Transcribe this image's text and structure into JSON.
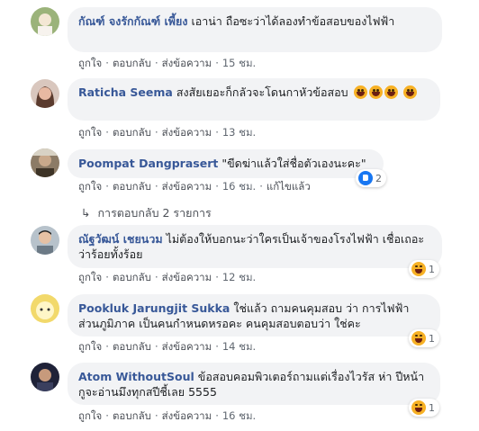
{
  "actions": {
    "like": "ถูกใจ",
    "reply": "ตอบกลับ",
    "message": "ส่งข้อความ",
    "edited": "แก้ไขแล้ว"
  },
  "comments": [
    {
      "name": "กัณฑ์ จงรักกัณฑ์ เพี้ยง",
      "text": "เอาน่า ถือซะว่าได้ลองทำข้อสอบของไฟฟ้า",
      "time": "15 ชม.",
      "avatar_color": "#9bb37a"
    },
    {
      "name": "Raticha Seema",
      "text": "สงสัยเยอะก็กลัวจะโดนกาหัวข้อสอบ",
      "time": "13 ชม.",
      "avatar_color": "#a87f72",
      "emoji": [
        "grinning-squint-emoji",
        "grinning-squint-emoji",
        "grinning-squint-emoji",
        "grinning-squint-emoji"
      ]
    },
    {
      "name": "Poompat Dangprasert",
      "text": "\"ขีดฆ่าแล้วใส่ชื่อตัวเองนะคะ\"",
      "time": "16 ชม.",
      "avatar_color": "#5f5040",
      "reaction": {
        "icon": "like-icon",
        "count": "2"
      }
    },
    {
      "name": "ณัฐวัฒน์ เชยนวม",
      "text": "ไม่ต้องให้บอกนะว่าใครเป็นเจ้าของโรงไฟฟ้า เชื่อเถอะว่าร้อยทั้งร้อย",
      "time": "12 ชม.",
      "avatar_color": "#6c7a86",
      "reaction": {
        "icon": "haha-icon",
        "count": "1"
      }
    },
    {
      "name": "Pookluk Jarungjit Sukka",
      "text": "ใช่แล้ว ถามคนคุมสอบ ว่า การไฟฟ้าส่วนภูมิภาค เป็นคนกำหนดหรอคะ คนคุมสอบตอบว่า ใช่คะ",
      "time": "14 ชม.",
      "avatar_color": "#f2d96b",
      "reaction": {
        "icon": "haha-icon",
        "count": "1"
      }
    },
    {
      "name": "Atom WithoutSoul",
      "text": "ข้อสอบคอมพิวเตอร์ถามแต่เรื่องไวรัส ห่า ปีหน้ากูจะอ่านมึงทุกสปีชี้เลย 5555",
      "time": "16 ชม.",
      "avatar_color": "#2a2e45",
      "reaction": {
        "icon": "haha-icon",
        "count": "1"
      }
    }
  ],
  "replies_label": "การตอบกลับ 2 รายการ"
}
